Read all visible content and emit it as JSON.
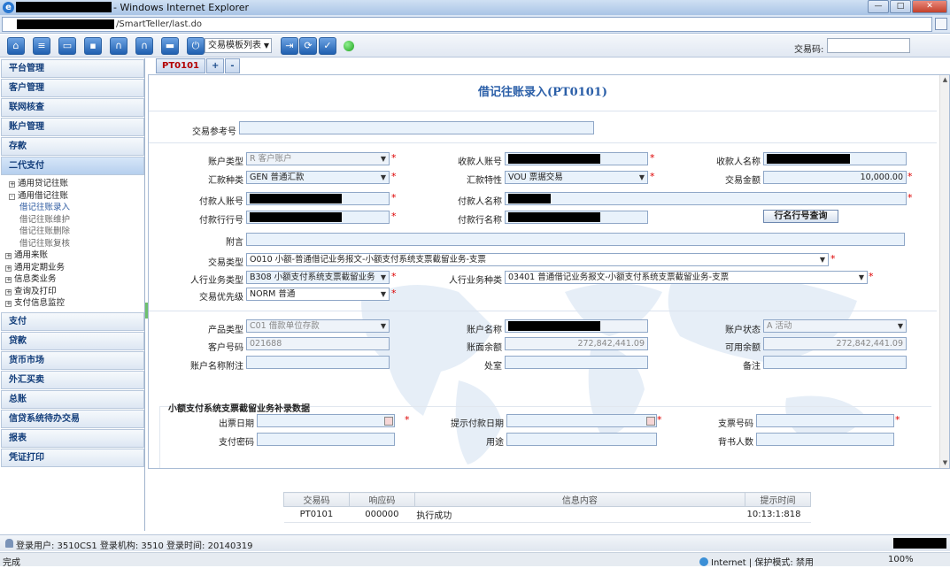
{
  "browser": {
    "title_suffix": "- Windows Internet Explorer",
    "url_suffix": "/SmartTeller/last.do",
    "win_min": "—",
    "win_max": "□",
    "win_close": "✕"
  },
  "toolbar": {
    "template_list": "交易模板列表",
    "tx_code_label": "交易码:"
  },
  "sidebar": {
    "top_items": [
      "平台管理",
      "客户管理",
      "联网核查",
      "账户管理",
      "存款",
      "二代支付"
    ],
    "tree": [
      {
        "level": 1,
        "toggle": "+",
        "label": "通用贷记往账"
      },
      {
        "level": 1,
        "toggle": "-",
        "label": "通用借记往账"
      },
      {
        "level": 2,
        "label": "借记往账录入"
      },
      {
        "level": 2,
        "label": "借记往账维护"
      },
      {
        "level": 2,
        "label": "借记往账删除"
      },
      {
        "level": 2,
        "label": "借记往账复核"
      },
      {
        "level": 1,
        "toggle": "+",
        "label": "通用来账"
      },
      {
        "level": 1,
        "toggle": "+",
        "label": "通用定期业务"
      },
      {
        "level": 1,
        "toggle": "+",
        "label": "信息类业务"
      },
      {
        "level": 1,
        "toggle": "+",
        "label": "查询及打印"
      },
      {
        "level": 1,
        "toggle": "+",
        "label": "支付信息监控"
      }
    ],
    "bottom_items": [
      "支付",
      "贷款",
      "货币市场",
      "外汇买卖",
      "总账",
      "信贷系统待办交易",
      "报表",
      "凭证打印"
    ]
  },
  "tabs": {
    "active": "PT0101",
    "add": "+",
    "remove": "-"
  },
  "form": {
    "title": "借记往账录入(PT0101)",
    "ref_label": "交易参考号",
    "ref_value": "",
    "account_type_label": "账户类型",
    "account_type_value": "R 客户账户",
    "payee_acct_label": "收款人账号",
    "payee_name_label": "收款人名称",
    "remit_type_label": "汇款种类",
    "remit_type_value": "GEN 普通汇款",
    "remit_attr_label": "汇款特性",
    "remit_attr_value": "VOU 票据交易",
    "amount_label": "交易金额",
    "amount_value": "10,000.00",
    "payer_acct_label": "付款人账号",
    "payer_name_label": "付款人名称",
    "payer_bank_label": "付款行行号",
    "payer_bank_name_label": "付款行名称",
    "bank_query_button": "行名行号查询",
    "remark_label": "附言",
    "tx_type_label": "交易类型",
    "tx_type_value": "O010 小额-普通借记业务报文-小额支付系统支票截留业务-支票",
    "pbc_biz_type_label": "人行业务类型",
    "pbc_biz_type_value": "B308 小额支付系统支票截留业务",
    "pbc_biz_kind_label": "人行业务种类",
    "pbc_biz_kind_value": "03401 普通借记业务报文-小额支付系统支票截留业务-支票",
    "priority_label": "交易优先级",
    "priority_value": "NORM 普通",
    "product_type_label": "产品类型",
    "product_type_value": "C01 借款单位存款",
    "acct_name_label": "账户名称",
    "acct_status_label": "账户状态",
    "acct_status_value": "A 活动",
    "cust_no_label": "客户号码",
    "cust_no_value": "021688",
    "book_balance_label": "账面余额",
    "book_balance_value": "272,842,441.09",
    "avail_balance_label": "可用余额",
    "avail_balance_value": "272,842,441.09",
    "acct_name_note_label": "账户名称附注",
    "location_label": "处室",
    "note_label": "备注",
    "supp_title": "小额支付系统支票截留业务补录数据",
    "issue_date_label": "出票日期",
    "pay_date_label": "提示付款日期",
    "cheque_no_label": "支票号码",
    "pay_pwd_label": "支付密码",
    "purpose_label": "用途",
    "endorse_label": "背书人数"
  },
  "messages": {
    "headers": [
      "交易码",
      "响应码",
      "信息内容",
      "提示时间"
    ],
    "rows": [
      {
        "code": "PT0101",
        "resp": "000000",
        "info": "执行成功",
        "time": "10:13:1:818"
      }
    ]
  },
  "status": {
    "login": "登录用户: 3510CS1 登录机构: 3510 登录时间: 20140319",
    "done": "完成",
    "zone": "Internet | 保护模式: 禁用",
    "zoom": "100%"
  }
}
